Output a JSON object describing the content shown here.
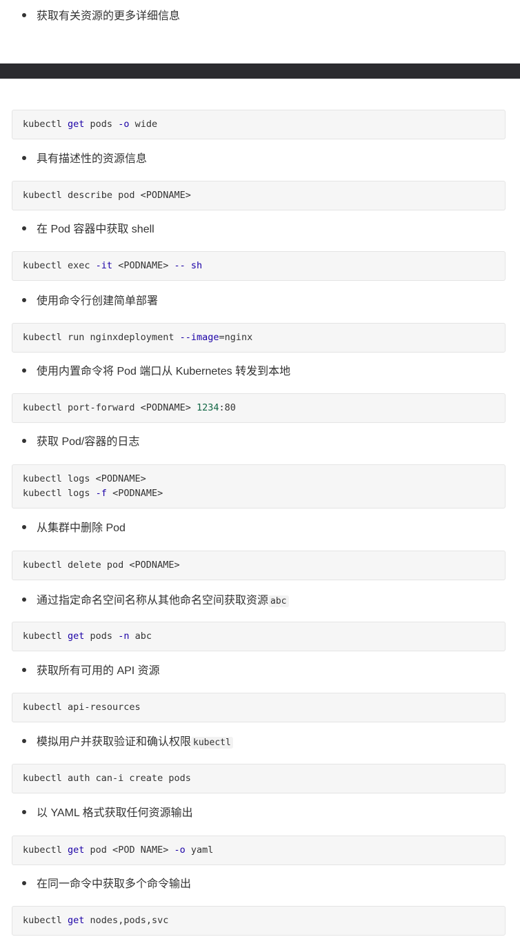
{
  "items": [
    {
      "text": "获取有关资源的更多详细信息"
    },
    {
      "text": "具有描述性的资源信息"
    },
    {
      "text": "在 Pod 容器中获取 shell"
    },
    {
      "text": "使用命令行创建简单部署"
    },
    {
      "text": "使用内置命令将 Pod 端口从 Kubernetes 转发到本地"
    },
    {
      "text": "获取 Pod/容器的日志"
    },
    {
      "text": "从集群中删除 Pod"
    },
    {
      "text": "通过指定命名空间名称从其他命名空间获取资源",
      "code": "abc"
    },
    {
      "text": "获取所有可用的 API 资源"
    },
    {
      "text": "模拟用户并获取验证和确认权限",
      "code": "kubectl"
    },
    {
      "text": "以 YAML 格式获取任何资源输出"
    },
    {
      "text": "在同一命令中获取多个命令输出"
    }
  ],
  "code_blocks": [
    {
      "lines": [
        [
          {
            "t": "kubectl "
          },
          {
            "t": "get",
            "k": "kw"
          },
          {
            "t": " pods "
          },
          {
            "t": "-o",
            "k": "kw"
          },
          {
            "t": " wide"
          }
        ]
      ]
    },
    {
      "lines": [
        [
          {
            "t": "kubectl describe pod <PODNAME>"
          }
        ]
      ]
    },
    {
      "lines": [
        [
          {
            "t": "kubectl exec "
          },
          {
            "t": "-it",
            "k": "kw"
          },
          {
            "t": " <PODNAME> "
          },
          {
            "t": "--",
            "k": "kw"
          },
          {
            "t": " "
          },
          {
            "t": "sh",
            "k": "kw"
          }
        ]
      ]
    },
    {
      "lines": [
        [
          {
            "t": "kubectl run nginxdeployment "
          },
          {
            "t": "--image",
            "k": "kw"
          },
          {
            "t": "=nginx"
          }
        ]
      ]
    },
    {
      "lines": [
        [
          {
            "t": "kubectl port-forward <PODNAME> "
          },
          {
            "t": "1234",
            "k": "num"
          },
          {
            "t": ":80"
          }
        ]
      ]
    },
    {
      "lines": [
        [
          {
            "t": "kubectl logs <PODNAME>"
          }
        ],
        [
          {
            "t": "kubectl logs "
          },
          {
            "t": "-f",
            "k": "kw"
          },
          {
            "t": " <PODNAME>"
          }
        ]
      ]
    },
    {
      "lines": [
        [
          {
            "t": "kubectl delete pod <PODNAME>"
          }
        ]
      ]
    },
    {
      "lines": [
        [
          {
            "t": "kubectl "
          },
          {
            "t": "get",
            "k": "kw"
          },
          {
            "t": " pods "
          },
          {
            "t": "-n",
            "k": "kw"
          },
          {
            "t": " abc"
          }
        ]
      ]
    },
    {
      "lines": [
        [
          {
            "t": "kubectl api-resources"
          }
        ]
      ]
    },
    {
      "lines": [
        [
          {
            "t": "kubectl auth can-i create pods"
          }
        ]
      ]
    },
    {
      "lines": [
        [
          {
            "t": "kubectl "
          },
          {
            "t": "get",
            "k": "kw"
          },
          {
            "t": " pod <POD NAME> "
          },
          {
            "t": "-o",
            "k": "kw"
          },
          {
            "t": " yaml"
          }
        ]
      ]
    },
    {
      "lines": [
        [
          {
            "t": "kubectl "
          },
          {
            "t": "get",
            "k": "kw"
          },
          {
            "t": " nodes,pods,svc"
          }
        ]
      ]
    }
  ]
}
